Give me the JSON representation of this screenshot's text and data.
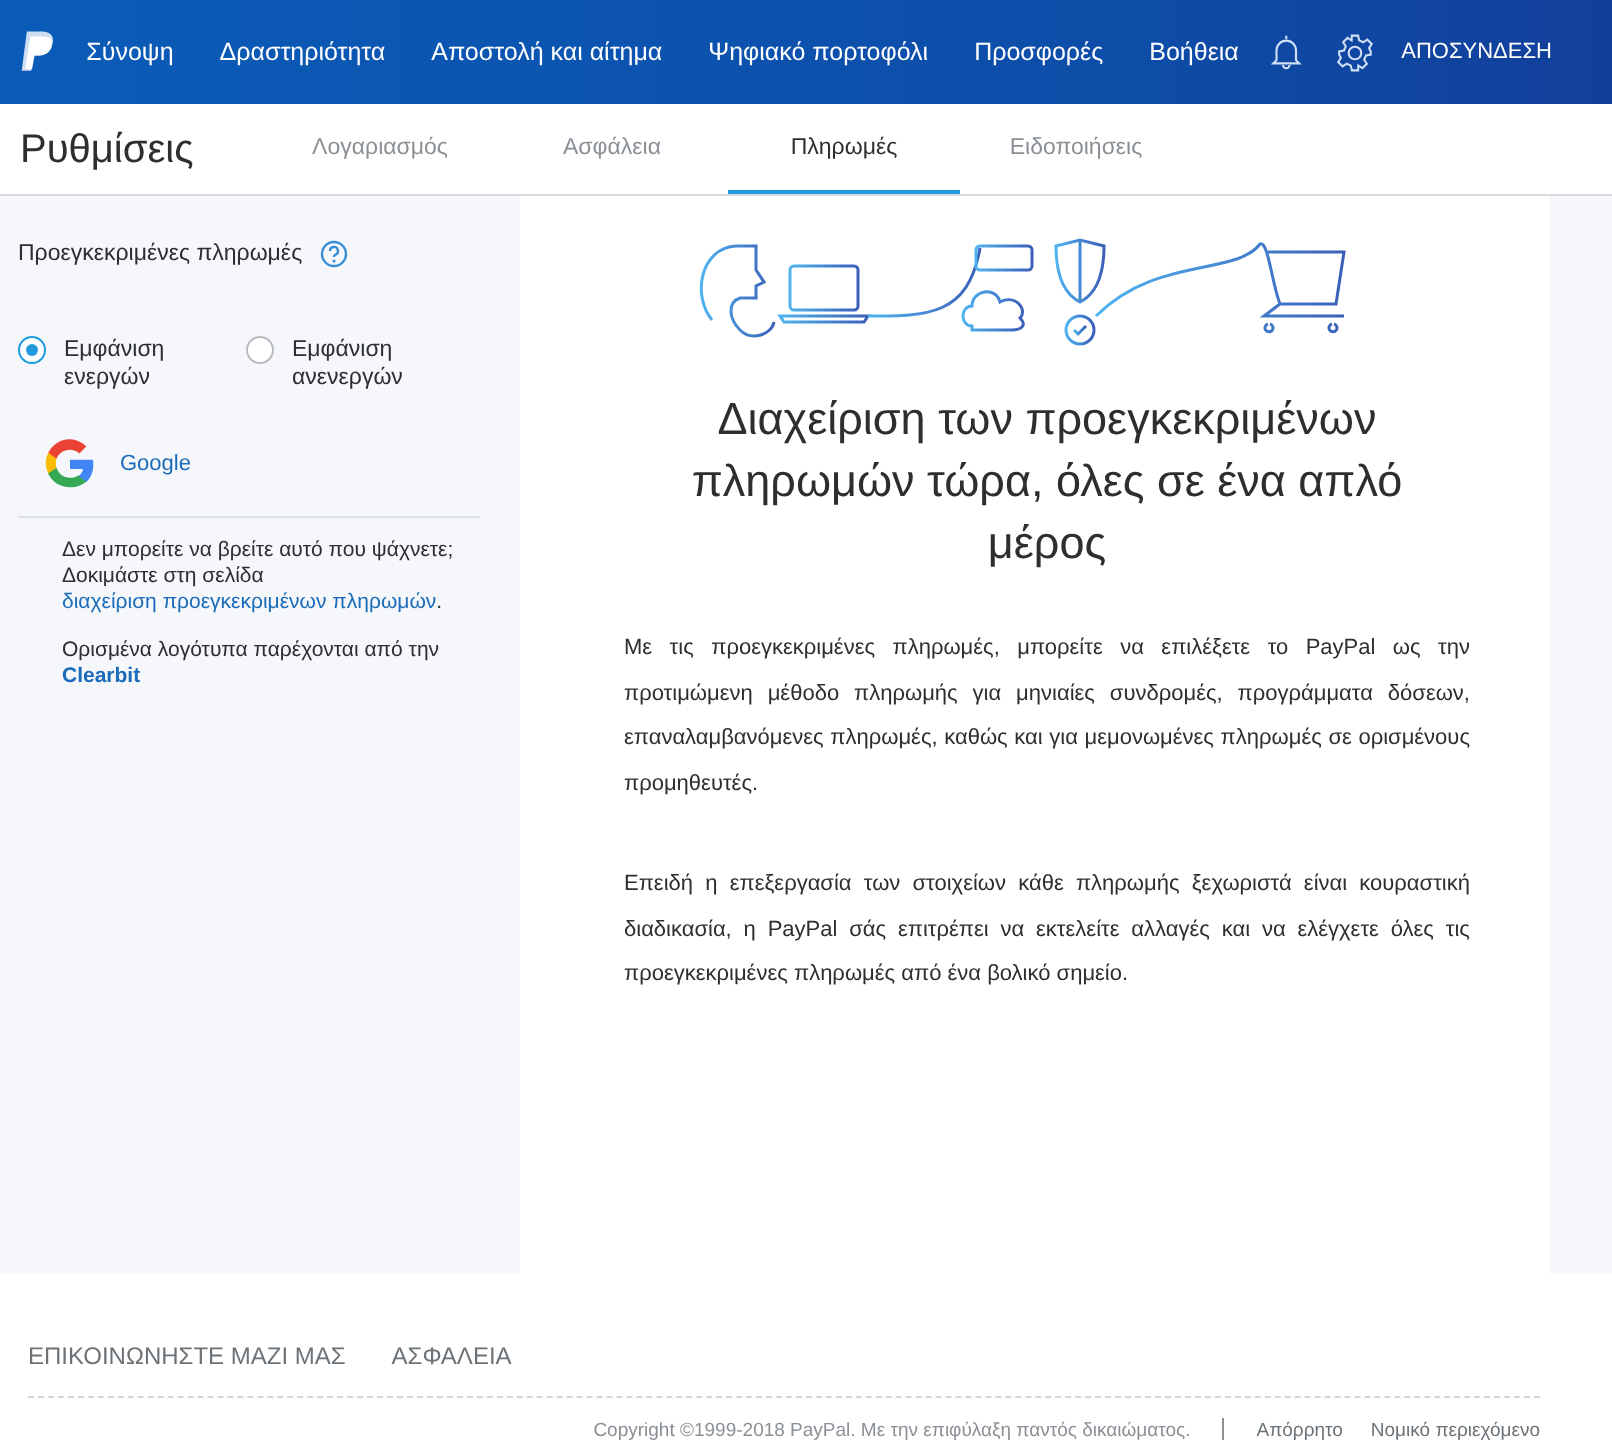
{
  "top_nav": {
    "items": [
      {
        "label": "Σύνοψη"
      },
      {
        "label": "Δραστηριότητα"
      },
      {
        "label": "Αποστολή και αίτημα"
      },
      {
        "label": "Ψηφιακό πορτοφόλι"
      },
      {
        "label": "Προσφορές"
      },
      {
        "label": "Βοήθεια"
      }
    ],
    "logout": "ΑΠΟΣΥΝΔΕΣΗ"
  },
  "settings": {
    "title": "Ρυθμίσεις",
    "tabs": [
      {
        "label": "Λογαριασμός",
        "selected": false
      },
      {
        "label": "Ασφάλεια",
        "selected": false
      },
      {
        "label": "Πληρωμές",
        "selected": true
      },
      {
        "label": "Ειδοποιήσεις",
        "selected": false
      }
    ]
  },
  "sidebar": {
    "heading": "Προεγκεκριμένες πληρωμές",
    "filters": [
      {
        "label": "Εμφάνιση ενεργών",
        "selected": true
      },
      {
        "label": "Εμφάνιση ανενεργών",
        "selected": false
      }
    ],
    "merchants": [
      {
        "name": "Google"
      }
    ],
    "help_text": "Δεν μπορείτε να βρείτε αυτό που ψάχνετε; Δοκιμάστε στη σελίδα ",
    "help_link": "διαχείριση προεγκεκριμένων πληρωμών",
    "help_end": ".",
    "logos_note": "Ορισμένα λογότυπα παρέχονται από την ",
    "logos_source": "Clearbit"
  },
  "main": {
    "title": "Διαχείριση των προεγκεκριμένων πληρωμών τώρα, όλες σε ένα απλό μέρος",
    "paragraphs": [
      "Με τις προεγκεκριμένες πληρωμές, μπορείτε να επιλέξετε το PayPal ως την προτιμώμενη μέθοδο πληρωμής για μηνιαίες συνδρομές, προγράμματα δόσεων, επαναλαμβανόμενες πληρωμές, καθώς και για μεμονωμένες πληρωμές σε ορισμένους προμηθευτές.",
      "Επειδή η επεξεργασία των στοιχείων κάθε πληρωμής ξεχωριστά είναι κουραστική διαδικασία, η PayPal σάς επιτρέπει να εκτελείτε αλλαγές και να ελέγχετε όλες τις προεγκεκριμένες πληρωμές από ένα βολικό σημείο."
    ]
  },
  "footer": {
    "links": [
      "ΕΠΙΚΟΙΝΩΝΗΣΤΕ ΜΑΖΙ ΜΑΣ",
      "ΑΣΦΑΛΕΙΑ"
    ],
    "copyright": "Copyright ©1999-2018 PayPal. Με την επιφύλαξη παντός δικαιώματος.",
    "legal_links": [
      "Απόρρητο",
      "Νομικό περιεχόμενο"
    ]
  }
}
